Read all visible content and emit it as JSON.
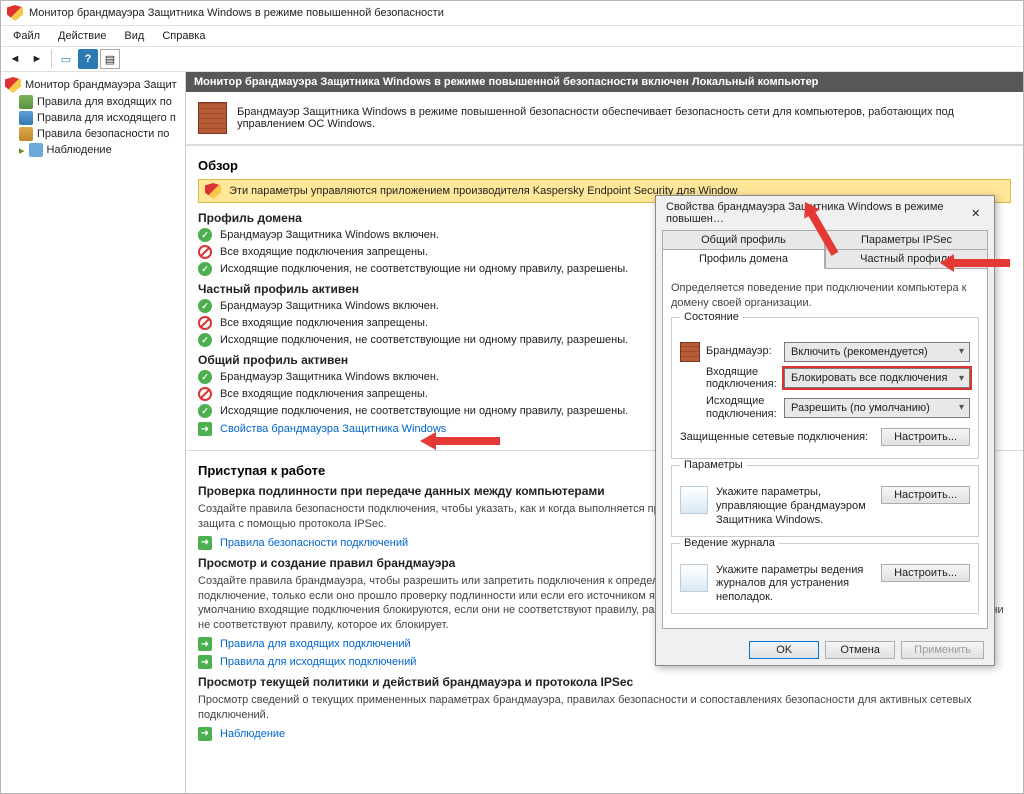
{
  "window": {
    "title": "Монитор брандмауэра Защитника Windows в режиме повышенной безопасности"
  },
  "menu": {
    "file": "Файл",
    "action": "Действие",
    "view": "Вид",
    "help": "Справка"
  },
  "tree": {
    "root": "Монитор брандмауэра Защит",
    "inbound": "Правила для входящих по",
    "outbound": "Правила для исходящего п",
    "security": "Правила безопасности по",
    "monitoring": "Наблюдение"
  },
  "header": {
    "bar": "Монитор брандмауэра Защитника Windows в режиме повышенной безопасности включен Локальный компьютер",
    "desc": "Брандмауэр Защитника Windows в режиме повышенной безопасности обеспечивает безопасность сети для компьютеров, работающих под управлением ОС Windows."
  },
  "overview": {
    "title": "Обзор",
    "warn": "Эти параметры управляются приложением производителя Kaspersky Endpoint Security для Window",
    "domain": {
      "head": "Профиль домена",
      "on": "Брандмауэр Защитника Windows включен.",
      "blockin": "Все входящие подключения запрещены.",
      "out": "Исходящие подключения, не соответствующие ни одному правилу, разрешены."
    },
    "private": {
      "head": "Частный профиль активен",
      "on": "Брандмауэр Защитника Windows включен.",
      "blockin": "Все входящие подключения запрещены.",
      "out": "Исходящие подключения, не соответствующие ни одному правилу, разрешены."
    },
    "public": {
      "head": "Общий профиль активен",
      "on": "Брандмауэр Защитника Windows включен.",
      "blockin": "Все входящие подключения запрещены.",
      "out": "Исходящие подключения, не соответствующие ни одному правилу, разрешены."
    },
    "propslink": "Свойства брандмауэра Защитника Windows"
  },
  "getstarted": {
    "title": "Приступая к работе",
    "auth": {
      "head": "Проверка подлинности при передаче данных между компьютерами",
      "text": "Создайте правила безопасности подключения, чтобы указать, как и когда выполняется проверка подлинности подключений между компьютерами и их защита с помощью протокола IPSec.",
      "link": "Правила безопасности подключений"
    },
    "rules": {
      "head": "Просмотр и создание правил брандмауэра",
      "text": "Создайте правила брандмауэра, чтобы разрешить или запретить подключения к определенным программам или портам.  Также можно разрешить подключение, только если оно прошло проверку подлинности или если его источником является авторизованный пользователь, группа или компьютер. По умолчанию входящие подключения блокируются, если они не соответствуют правилу, разрешающему их, а исходящие подключения разрешаются, если они не соответствуют правилу, которое их блокирует.",
      "link_in": "Правила для входящих подключений",
      "link_out": "Правила для исходящих подключений"
    },
    "policy": {
      "head": "Просмотр текущей политики и действий брандмауэра и протокола IPSec",
      "text": "Просмотр сведений о текущих примененных параметрах брандмауэра, правилах безопасности и сопоставлениях безопасности для активных сетевых подключений.",
      "link": "Наблюдение"
    }
  },
  "dialog": {
    "title": "Свойства брандмауэра Защитника Windows в режиме повышен…",
    "tab_public": "Общий профиль",
    "tab_ipsec": "Параметры IPSec",
    "tab_domain": "Профиль домена",
    "tab_private": "Частный профиль",
    "tabdesc": "Определяется поведение при подключении компьютера к домену своей организации.",
    "grp_state": "Состояние",
    "lbl_fw": "Брандмауэр:",
    "val_fw": "Включить (рекомендуется)",
    "lbl_in": "Входящие подключения:",
    "val_in": "Блокировать все подключения",
    "lbl_out": "Исходящие подключения:",
    "val_out": "Разрешить (по умолчанию)",
    "lbl_protected": "Защищенные сетевые подключения:",
    "btn_custom": "Настроить...",
    "grp_params": "Параметры",
    "params_text": "Укажите параметры, управляющие брандмауэром Защитника Windows.",
    "grp_log": "Ведение журнала",
    "log_text": "Укажите параметры ведения журналов для устранения неполадок.",
    "btn_ok": "OK",
    "btn_cancel": "Отмена",
    "btn_apply": "Применить"
  }
}
